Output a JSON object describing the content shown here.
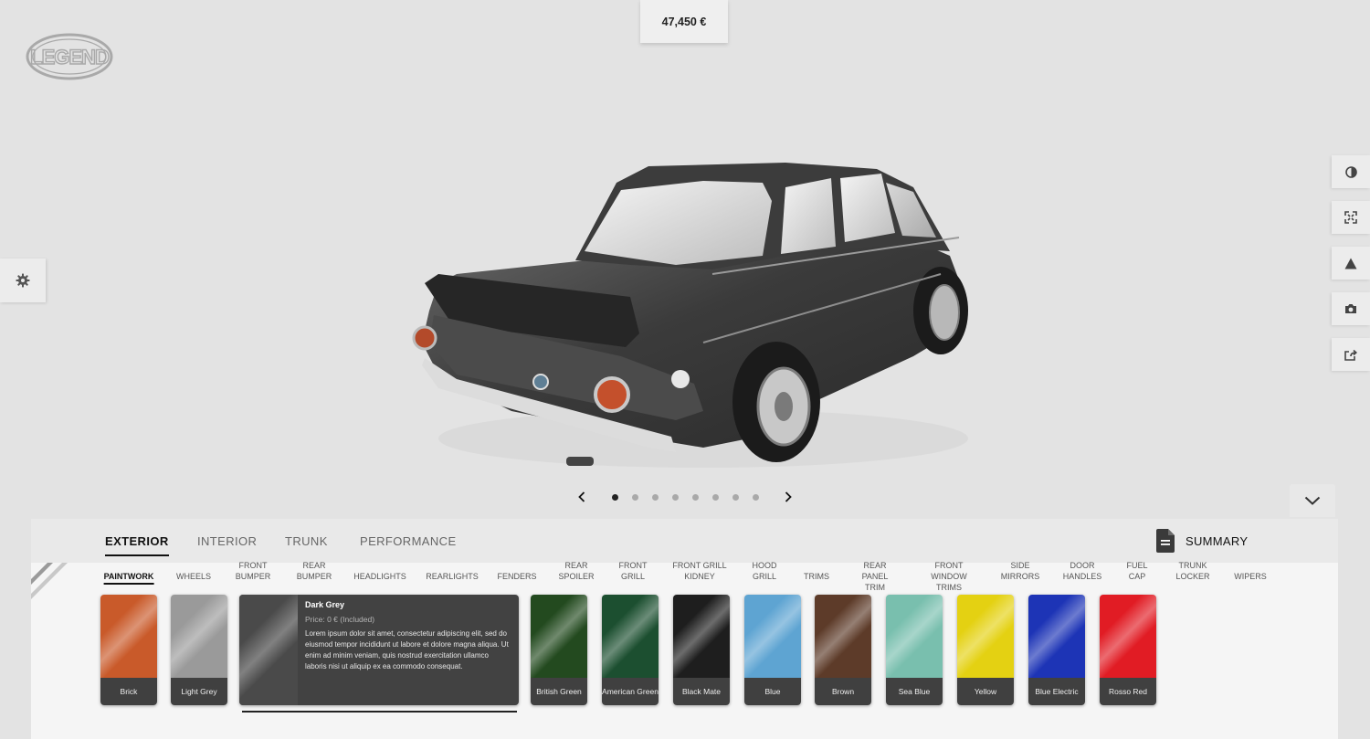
{
  "price": "47,450 €",
  "logo": {
    "name": "LEGEND",
    "color": "#a9a9a9"
  },
  "tabs": [
    {
      "label": "EXTERIOR",
      "active": true
    },
    {
      "label": "INTERIOR",
      "active": false
    },
    {
      "label": "TRUNK",
      "active": false
    },
    {
      "label": "PERFORMANCE",
      "active": false
    }
  ],
  "summary_label": "SUMMARY",
  "subcategories": [
    {
      "line1": "PAINTWORK",
      "line2": "",
      "active": true
    },
    {
      "line1": "WHEELS",
      "line2": ""
    },
    {
      "line1": "FRONT",
      "line2": "BUMPER"
    },
    {
      "line1": "REAR",
      "line2": "BUMPER"
    },
    {
      "line1": "HEADLIGHTS",
      "line2": ""
    },
    {
      "line1": "REARLIGHTS",
      "line2": ""
    },
    {
      "line1": "FENDERS",
      "line2": ""
    },
    {
      "line1": "REAR",
      "line2": "SPOILER"
    },
    {
      "line1": "FRONT",
      "line2": "GRILL"
    },
    {
      "line1": "FRONT GRILL",
      "line2": "KIDNEY"
    },
    {
      "line1": "HOOD",
      "line2": "GRILL"
    },
    {
      "line1": "TRIMS",
      "line2": ""
    },
    {
      "line1": "REAR",
      "line2": "PANEL",
      "line3": "TRIM"
    },
    {
      "line1": "FRONT",
      "line2": "WINDOW",
      "line3": "TRIMS"
    },
    {
      "line1": "SIDE",
      "line2": "MIRRORS"
    },
    {
      "line1": "DOOR",
      "line2": "HANDLES"
    },
    {
      "line1": "FUEL",
      "line2": "CAP"
    },
    {
      "line1": "TRUNK",
      "line2": "LOCKER"
    },
    {
      "line1": "WIPERS",
      "line2": ""
    }
  ],
  "swatches": [
    {
      "label": "Brick",
      "color": "#c95a2a"
    },
    {
      "label": "Light Grey",
      "color": "#9a9a9a"
    },
    {
      "label": "British Green",
      "color": "#234a1f"
    },
    {
      "label": "American Green",
      "color": "#1c4f30"
    },
    {
      "label": "Black Mate",
      "color": "#1e1e1e"
    },
    {
      "label": "Blue",
      "color": "#5ea4d2"
    },
    {
      "label": "Brown",
      "color": "#5d3b29"
    },
    {
      "label": "Sea Blue",
      "color": "#79bfae"
    },
    {
      "label": "Yellow",
      "color": "#e4d112"
    },
    {
      "label": "Blue Electric",
      "color": "#1d34b6"
    },
    {
      "label": "Rosso Red",
      "color": "#e11c24"
    }
  ],
  "selected": {
    "name": "Dark Grey",
    "price": "Price: 0 € (Included)",
    "description": "Lorem ipsum dolor sit amet, consectetur adipiscing elit, sed do eiusmod tempor incididunt ut labore et dolore magna aliqua. Ut enim ad minim veniam, quis nostrud exercitation ullamco laboris nisi ut aliquip ex ea commodo consequat.",
    "color": "#4a4a4a"
  },
  "carousel": {
    "count": 8,
    "active_index": 0
  },
  "icons": {
    "settings": "gear-icon",
    "tools": [
      "contrast-icon",
      "fullscreen-icon",
      "warning-icon",
      "camera-icon",
      "share-icon"
    ],
    "collapse": "chevron-down-icon",
    "summary": "document-icon",
    "prev": "chevron-left-icon",
    "next": "chevron-right-icon"
  }
}
